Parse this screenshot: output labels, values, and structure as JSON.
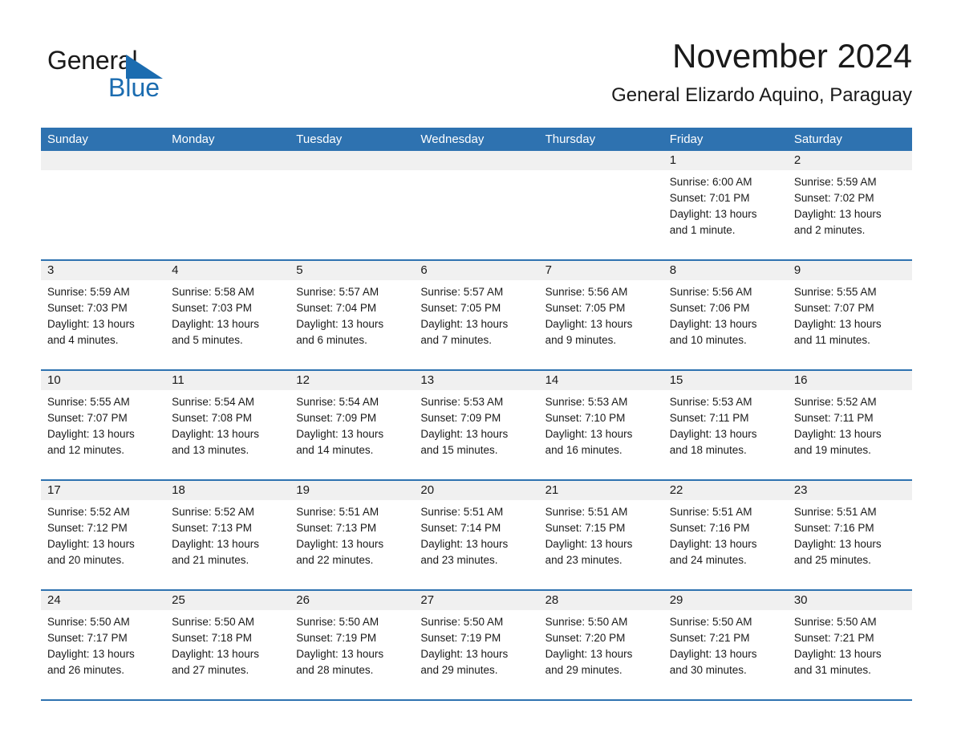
{
  "brand": {
    "line1": "General",
    "line2": "Blue",
    "logo_icon": "triangle-flag-icon"
  },
  "header": {
    "title": "November 2024",
    "subtitle": "General Elizardo Aquino, Paraguay"
  },
  "calendar": {
    "weekdays": [
      "Sunday",
      "Monday",
      "Tuesday",
      "Wednesday",
      "Thursday",
      "Friday",
      "Saturday"
    ],
    "accent_color": "#2e72b0",
    "day_strip_color": "#f0f0f0",
    "weeks": [
      [
        {
          "date": "",
          "lines": []
        },
        {
          "date": "",
          "lines": []
        },
        {
          "date": "",
          "lines": []
        },
        {
          "date": "",
          "lines": []
        },
        {
          "date": "",
          "lines": []
        },
        {
          "date": "1",
          "lines": [
            "Sunrise: 6:00 AM",
            "Sunset: 7:01 PM",
            "Daylight: 13 hours",
            "and 1 minute."
          ]
        },
        {
          "date": "2",
          "lines": [
            "Sunrise: 5:59 AM",
            "Sunset: 7:02 PM",
            "Daylight: 13 hours",
            "and 2 minutes."
          ]
        }
      ],
      [
        {
          "date": "3",
          "lines": [
            "Sunrise: 5:59 AM",
            "Sunset: 7:03 PM",
            "Daylight: 13 hours",
            "and 4 minutes."
          ]
        },
        {
          "date": "4",
          "lines": [
            "Sunrise: 5:58 AM",
            "Sunset: 7:03 PM",
            "Daylight: 13 hours",
            "and 5 minutes."
          ]
        },
        {
          "date": "5",
          "lines": [
            "Sunrise: 5:57 AM",
            "Sunset: 7:04 PM",
            "Daylight: 13 hours",
            "and 6 minutes."
          ]
        },
        {
          "date": "6",
          "lines": [
            "Sunrise: 5:57 AM",
            "Sunset: 7:05 PM",
            "Daylight: 13 hours",
            "and 7 minutes."
          ]
        },
        {
          "date": "7",
          "lines": [
            "Sunrise: 5:56 AM",
            "Sunset: 7:05 PM",
            "Daylight: 13 hours",
            "and 9 minutes."
          ]
        },
        {
          "date": "8",
          "lines": [
            "Sunrise: 5:56 AM",
            "Sunset: 7:06 PM",
            "Daylight: 13 hours",
            "and 10 minutes."
          ]
        },
        {
          "date": "9",
          "lines": [
            "Sunrise: 5:55 AM",
            "Sunset: 7:07 PM",
            "Daylight: 13 hours",
            "and 11 minutes."
          ]
        }
      ],
      [
        {
          "date": "10",
          "lines": [
            "Sunrise: 5:55 AM",
            "Sunset: 7:07 PM",
            "Daylight: 13 hours",
            "and 12 minutes."
          ]
        },
        {
          "date": "11",
          "lines": [
            "Sunrise: 5:54 AM",
            "Sunset: 7:08 PM",
            "Daylight: 13 hours",
            "and 13 minutes."
          ]
        },
        {
          "date": "12",
          "lines": [
            "Sunrise: 5:54 AM",
            "Sunset: 7:09 PM",
            "Daylight: 13 hours",
            "and 14 minutes."
          ]
        },
        {
          "date": "13",
          "lines": [
            "Sunrise: 5:53 AM",
            "Sunset: 7:09 PM",
            "Daylight: 13 hours",
            "and 15 minutes."
          ]
        },
        {
          "date": "14",
          "lines": [
            "Sunrise: 5:53 AM",
            "Sunset: 7:10 PM",
            "Daylight: 13 hours",
            "and 16 minutes."
          ]
        },
        {
          "date": "15",
          "lines": [
            "Sunrise: 5:53 AM",
            "Sunset: 7:11 PM",
            "Daylight: 13 hours",
            "and 18 minutes."
          ]
        },
        {
          "date": "16",
          "lines": [
            "Sunrise: 5:52 AM",
            "Sunset: 7:11 PM",
            "Daylight: 13 hours",
            "and 19 minutes."
          ]
        }
      ],
      [
        {
          "date": "17",
          "lines": [
            "Sunrise: 5:52 AM",
            "Sunset: 7:12 PM",
            "Daylight: 13 hours",
            "and 20 minutes."
          ]
        },
        {
          "date": "18",
          "lines": [
            "Sunrise: 5:52 AM",
            "Sunset: 7:13 PM",
            "Daylight: 13 hours",
            "and 21 minutes."
          ]
        },
        {
          "date": "19",
          "lines": [
            "Sunrise: 5:51 AM",
            "Sunset: 7:13 PM",
            "Daylight: 13 hours",
            "and 22 minutes."
          ]
        },
        {
          "date": "20",
          "lines": [
            "Sunrise: 5:51 AM",
            "Sunset: 7:14 PM",
            "Daylight: 13 hours",
            "and 23 minutes."
          ]
        },
        {
          "date": "21",
          "lines": [
            "Sunrise: 5:51 AM",
            "Sunset: 7:15 PM",
            "Daylight: 13 hours",
            "and 23 minutes."
          ]
        },
        {
          "date": "22",
          "lines": [
            "Sunrise: 5:51 AM",
            "Sunset: 7:16 PM",
            "Daylight: 13 hours",
            "and 24 minutes."
          ]
        },
        {
          "date": "23",
          "lines": [
            "Sunrise: 5:51 AM",
            "Sunset: 7:16 PM",
            "Daylight: 13 hours",
            "and 25 minutes."
          ]
        }
      ],
      [
        {
          "date": "24",
          "lines": [
            "Sunrise: 5:50 AM",
            "Sunset: 7:17 PM",
            "Daylight: 13 hours",
            "and 26 minutes."
          ]
        },
        {
          "date": "25",
          "lines": [
            "Sunrise: 5:50 AM",
            "Sunset: 7:18 PM",
            "Daylight: 13 hours",
            "and 27 minutes."
          ]
        },
        {
          "date": "26",
          "lines": [
            "Sunrise: 5:50 AM",
            "Sunset: 7:19 PM",
            "Daylight: 13 hours",
            "and 28 minutes."
          ]
        },
        {
          "date": "27",
          "lines": [
            "Sunrise: 5:50 AM",
            "Sunset: 7:19 PM",
            "Daylight: 13 hours",
            "and 29 minutes."
          ]
        },
        {
          "date": "28",
          "lines": [
            "Sunrise: 5:50 AM",
            "Sunset: 7:20 PM",
            "Daylight: 13 hours",
            "and 29 minutes."
          ]
        },
        {
          "date": "29",
          "lines": [
            "Sunrise: 5:50 AM",
            "Sunset: 7:21 PM",
            "Daylight: 13 hours",
            "and 30 minutes."
          ]
        },
        {
          "date": "30",
          "lines": [
            "Sunrise: 5:50 AM",
            "Sunset: 7:21 PM",
            "Daylight: 13 hours",
            "and 31 minutes."
          ]
        }
      ]
    ]
  }
}
